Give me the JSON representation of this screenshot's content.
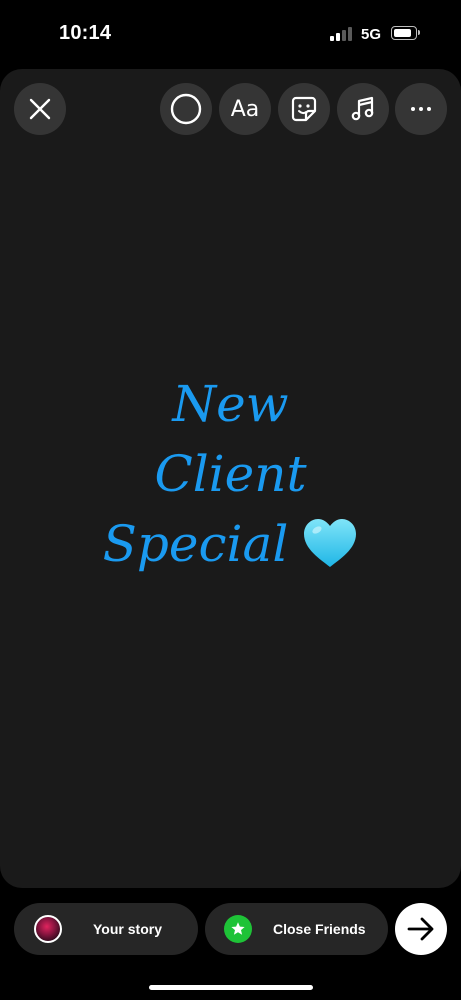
{
  "status_bar": {
    "time": "10:14",
    "network": "5G"
  },
  "toolbar": {
    "close_icon": "close-icon",
    "draw_icon": "circle-outline-icon",
    "text_tool_label": "Aa",
    "sticker_icon": "sticker-icon",
    "music_icon": "music-note-icon",
    "more_icon": "more-icon"
  },
  "story": {
    "lines": [
      "New",
      "Client",
      "Special"
    ],
    "emoji": "light-blue-heart",
    "text_color": "#1a9af0",
    "emoji_color": "#3fd0f0"
  },
  "bottom_bar": {
    "your_story_label": "Your story",
    "close_friends_label": "Close Friends",
    "close_friends_color": "#1ec337",
    "next_icon": "arrow-right-icon"
  }
}
